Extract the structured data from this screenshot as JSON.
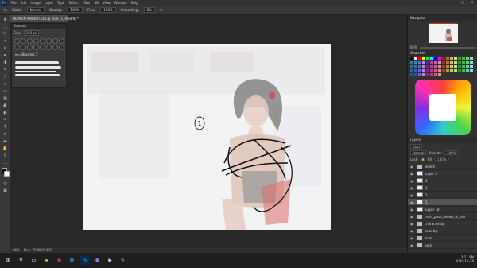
{
  "app": {
    "logo": "Ps",
    "window_controls": [
      "—",
      "□",
      "✕"
    ]
  },
  "menu": [
    "File",
    "Edit",
    "Image",
    "Layer",
    "Type",
    "Select",
    "Filter",
    "3D",
    "View",
    "Window",
    "Help"
  ],
  "options": {
    "mode_label": "Mode:",
    "mode": "Normal",
    "opacity_label": "Opacity:",
    "opacity": "100%",
    "flow_label": "Flow:",
    "flow": "100%",
    "smoothing_label": "Smoothing:",
    "smoothing": "0%"
  },
  "document": {
    "tab": "DOMAIN Webfish.psd @ 66% (1, RGB/8) *",
    "status": "66%",
    "status_doc": "Doc: 25.9M/1.43G"
  },
  "brush_panel": {
    "title": "Brushes",
    "size_label": "Size:",
    "size_value": "150 px",
    "folder": "Brushes 1"
  },
  "canvas": {
    "annotation": "1"
  },
  "navigator": {
    "title": "Navigator",
    "zoom": "66%"
  },
  "swatches": {
    "title": "Swatches"
  },
  "layers": {
    "title": "Layers",
    "kind": "Kind",
    "blend": "Normal",
    "opacity_label": "Opacity:",
    "opacity": "100%",
    "lock_label": "Lock:",
    "fill_label": "Fill:",
    "fill": "100%",
    "items": [
      {
        "name": "sketch",
        "type": "folder",
        "selected": false
      },
      {
        "name": "Layer 5",
        "type": "layer",
        "selected": false
      },
      {
        "name": "4",
        "type": "layer",
        "selected": false
      },
      {
        "name": "3",
        "type": "layer",
        "selected": false
      },
      {
        "name": "2",
        "type": "layer",
        "selected": false
      },
      {
        "name": "1",
        "type": "layer",
        "selected": true
      },
      {
        "name": "Layer 18",
        "type": "layer",
        "selected": false
      },
      {
        "name": "main_pose_lineart_w_hair",
        "type": "folder",
        "selected": false
      },
      {
        "name": "character-bg",
        "type": "folder",
        "selected": false
      },
      {
        "name": "color-bg",
        "type": "folder",
        "selected": false
      },
      {
        "name": "lines",
        "type": "folder",
        "selected": false
      },
      {
        "name": "back",
        "type": "folder",
        "selected": false
      }
    ]
  },
  "taskbar": {
    "time": "2:11 PM",
    "date": "2020-11-26"
  },
  "colors": {
    "accent": "#31a8ff",
    "swatch_row": [
      "#000000",
      "#ffffff",
      "#ff0000",
      "#ffff00",
      "#00ff00",
      "#00ffff",
      "#0000ff",
      "#ff00ff"
    ]
  }
}
